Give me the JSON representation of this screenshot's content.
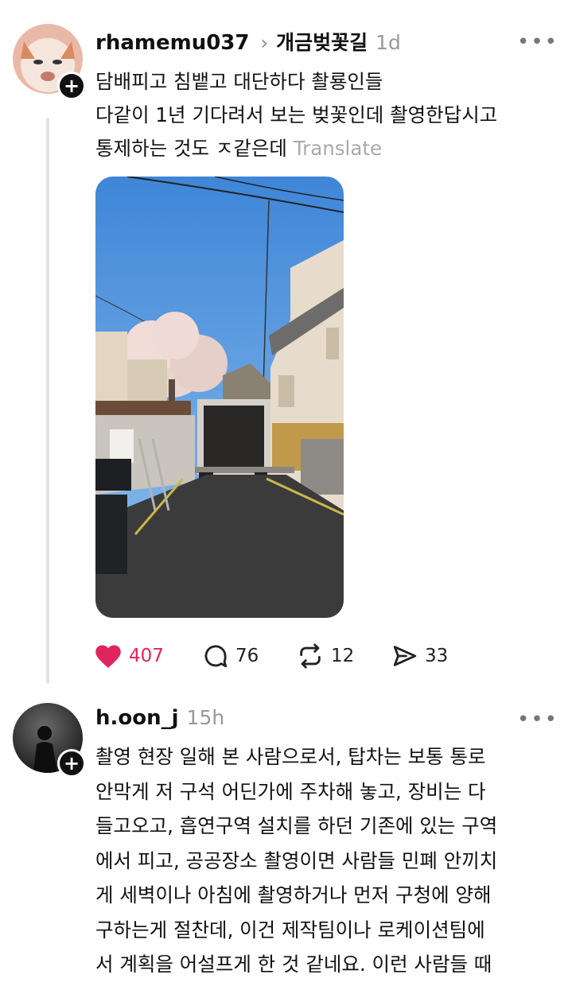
{
  "post1": {
    "username": "rhamemu037",
    "community": "개금벚꽃길",
    "time": "1d",
    "text": "담배피고 침뱉고 대단하다 촬룡인들\n다같이 1년 기다려서 보는 벚꽃인데 촬영한답시고\n통제하는 것도 ㅈ같은데",
    "translate": "Translate",
    "likes": "407",
    "comments": "76",
    "reposts": "12",
    "shares": "33",
    "like_color": "#e0245e"
  },
  "post2": {
    "username": "h.oon_j",
    "time": "15h",
    "text": "촬영 현장 일해 본 사람으로서, 탑차는 보통 통로\n안막게 저 구석 어딘가에 주차해 놓고, 장비는 다\n들고오고, 흡연구역 설치를 하던 기존에 있는 구역\n에서 피고, 공공장소 촬영이면 사람들 민폐 안끼치\n게 세벽이나 아침에 촬영하거나 먼저 구청에 양해\n구하는게 절찬데, 이건 제작팀이나 로케이션팀에\n서 계획을 어설프게 한 것 같네요. 이런 사람들 때"
  },
  "icons": {
    "plus": "+",
    "chevron": "›",
    "more": "•••"
  }
}
